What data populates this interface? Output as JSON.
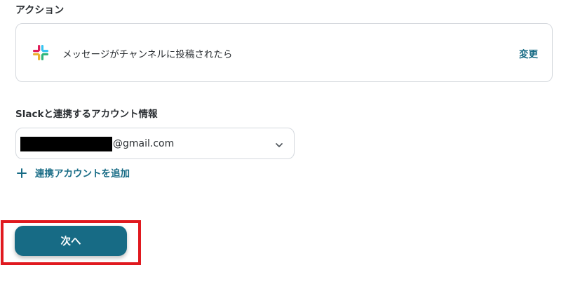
{
  "section": {
    "title": "アクション"
  },
  "action": {
    "icon": "slack-logo-icon",
    "title": "メッセージがチャンネルに投稿されたら",
    "change_label": "変更"
  },
  "account": {
    "label": "Slackと連携するアカウント情報",
    "email_suffix": "@gmail.com",
    "dropdown_icon": "chevron-down-icon"
  },
  "add_account": {
    "icon": "plus-icon",
    "label": "連携アカウントを追加"
  },
  "next_button": {
    "label": "次へ"
  },
  "colors": {
    "accent": "#176b85",
    "highlight": "#e0191f",
    "border": "#d5d9de",
    "text": "#2b2f33"
  }
}
